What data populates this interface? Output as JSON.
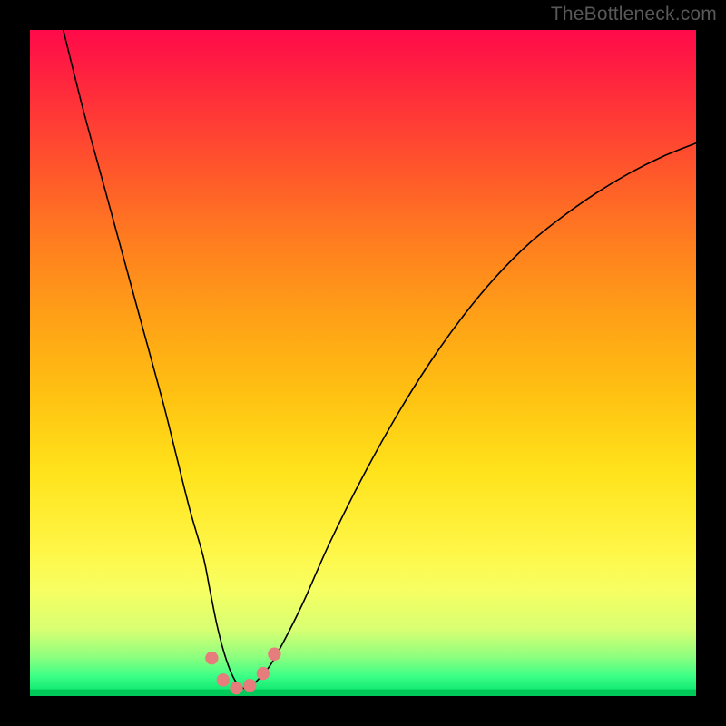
{
  "watermark": "TheBottleneck.com",
  "chart_data": {
    "type": "line",
    "title": "",
    "xlabel": "",
    "ylabel": "",
    "xlim": [
      0,
      100
    ],
    "ylim": [
      0,
      100
    ],
    "series": [
      {
        "name": "curve",
        "x": [
          5,
          8,
          11,
          14,
          17,
          20,
          22,
          24,
          26,
          27,
          28,
          29,
          30,
          31,
          32,
          33,
          34,
          36,
          38,
          41,
          45,
          50,
          55,
          60,
          65,
          70,
          75,
          80,
          85,
          90,
          95,
          100
        ],
        "y": [
          100,
          88,
          77,
          66,
          55,
          44,
          36,
          28,
          21,
          16,
          11,
          7,
          4,
          2,
          1.2,
          1.3,
          2.2,
          4.5,
          8,
          14,
          23,
          33,
          42,
          50,
          57,
          63,
          68,
          72,
          75.5,
          78.5,
          81,
          83
        ]
      }
    ],
    "markers": {
      "name": "bottom-markers",
      "color": "#e77c7c",
      "points": [
        {
          "x": 27.3,
          "y": 5.7
        },
        {
          "x": 29.0,
          "y": 2.4
        },
        {
          "x": 31.0,
          "y": 1.2
        },
        {
          "x": 33.0,
          "y": 1.6
        },
        {
          "x": 35.0,
          "y": 3.4
        },
        {
          "x": 36.7,
          "y": 6.3
        }
      ]
    },
    "bottom_band": {
      "color": "#00c859",
      "y": 0,
      "height": 1.0
    }
  }
}
